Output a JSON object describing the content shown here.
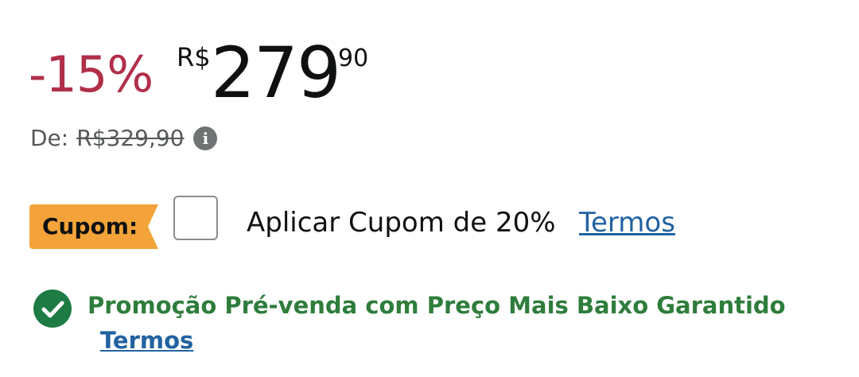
{
  "price": {
    "discount": "-15%",
    "currency": "R$",
    "whole": "279",
    "cents": "90",
    "list_label": "De:",
    "list_value": "R$329,90",
    "info_icon": "info-icon"
  },
  "coupon": {
    "badge_label": "Cupom:",
    "apply_label": "Aplicar Cupom de 20%",
    "terms_label": "Termos",
    "checked": false
  },
  "promo": {
    "icon": "check-circle-icon",
    "text": "Promoção Pré-venda com Preço Mais Baixo Garantido",
    "terms_label": "Termos"
  },
  "colors": {
    "discount": "#B12F4B",
    "badge": "#F3A33A",
    "link": "#2162A1",
    "promo_green": "#2E7D3C"
  }
}
